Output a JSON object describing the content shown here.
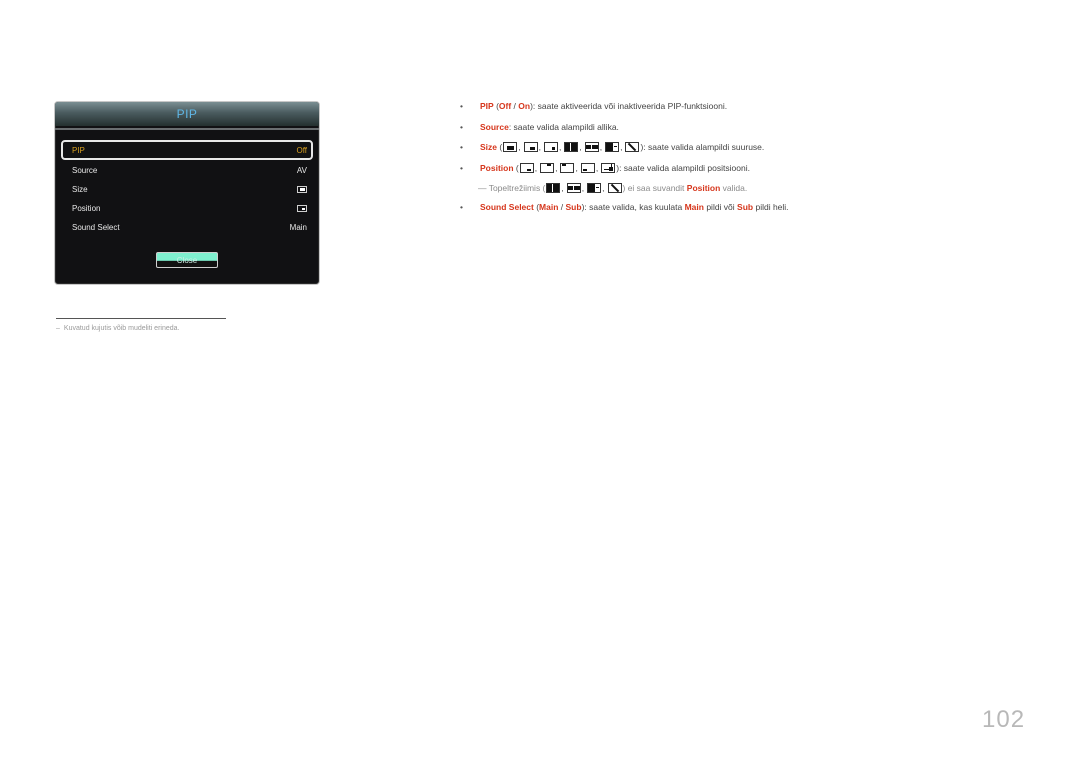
{
  "osd": {
    "title": "PIP",
    "rows": [
      {
        "label": "PIP",
        "value": "Off",
        "selected": true
      },
      {
        "label": "Source",
        "value": "AV"
      },
      {
        "label": "Size",
        "icon": "size-small-icon"
      },
      {
        "label": "Position",
        "icon": "position-bottom-right-icon"
      },
      {
        "label": "Sound Select",
        "value": "Main"
      }
    ],
    "close_label": "Close"
  },
  "footnote": {
    "dash": "–",
    "text": "Kuvatud kujutis võib mudeliti erineda."
  },
  "bullets": {
    "pip": {
      "kw": "PIP",
      "open": " (",
      "off": "Off",
      "slash": " / ",
      "on": "On",
      "rest": "): saate aktiveerida või inaktiveerida PIP-funktsiooni."
    },
    "source": {
      "kw": "Source",
      "rest": ": saate valida alampildi allika."
    },
    "size": {
      "kw": "Size",
      "open": " (",
      "rest": "): saate valida alampildi suuruse.",
      "icons": [
        "pip-large-icon",
        "pip-medium-icon",
        "pip-small-icon",
        "pbp-split-icon",
        "pbp-split-small-icon",
        "pbp-split-partial-icon",
        "full-diagonal-icon"
      ]
    },
    "position": {
      "kw": "Position",
      "open": " (",
      "rest": "): saate valida alampildi positsiooni.",
      "icons": [
        "pos-bottom-right-icon",
        "pos-top-right-icon",
        "pos-top-left-icon",
        "pos-bottom-left-icon",
        "pos-move-icon"
      ]
    },
    "note": {
      "dash": "―",
      "pre": " Topeltrežiimis (",
      "mid": ") ei saa suvandit ",
      "kw": "Position",
      "post": " valida.",
      "icons": [
        "pbp-split-icon",
        "pbp-split-small-icon",
        "pbp-split-partial-icon",
        "full-diagonal-icon"
      ]
    },
    "sound": {
      "kw": "Sound Select",
      "open": " (",
      "main": "Main",
      "slash": " / ",
      "sub": "Sub",
      "mid": "): saate valida, kas kuulata ",
      "main2": "Main",
      "mid2": " pildi või ",
      "sub2": "Sub",
      "post": " pildi heli."
    }
  },
  "bullet_char": "•",
  "page_number": "102",
  "colors": {
    "keyword": "#d6361c",
    "osd_selected": "#d9a020",
    "osd_title": "#5fb7e6",
    "close_button": "#7ff0cf"
  }
}
